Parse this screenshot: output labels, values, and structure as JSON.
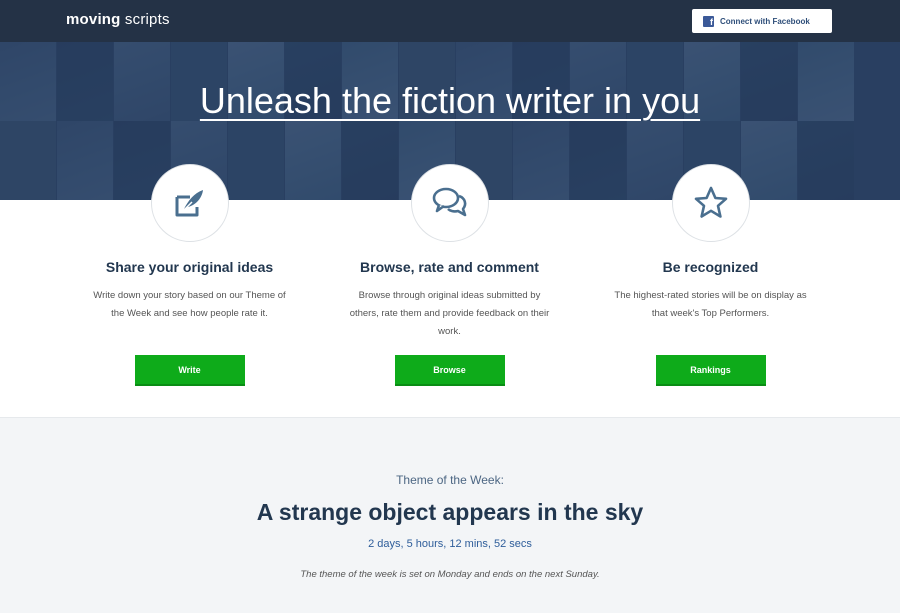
{
  "nav": {
    "logo_bold": "moving",
    "logo_light": "scripts",
    "facebook_label": "Connect with Facebook",
    "facebook_icon": "f"
  },
  "hero": {
    "title": "Unleash the fiction writer in you"
  },
  "features": [
    {
      "icon": "write-quill-icon",
      "title": "Share your original ideas",
      "text": "Write down your story based on our Theme of the Week and see how people rate it.",
      "button": "Write"
    },
    {
      "icon": "chat-bubbles-icon",
      "title": "Browse, rate and comment",
      "text": "Browse through original ideas submitted by others, rate them and provide feedback on their work.",
      "button": "Browse"
    },
    {
      "icon": "star-icon",
      "title": "Be recognized",
      "text": "The highest-rated stories will be on display as that week's Top Performers.",
      "button": "Rankings"
    }
  ],
  "theme": {
    "label": "Theme of the Week:",
    "title": "A strange object appears in the sky",
    "countdown": "2 days, 5 hours, 12 mins, 52 secs",
    "note": "The theme of the week is set on Monday and ends on the next Sunday."
  },
  "colors": {
    "nav_bg": "#243246",
    "accent_green": "#0eab1a",
    "heading": "#22374f",
    "facebook_blue": "#3b5998"
  }
}
